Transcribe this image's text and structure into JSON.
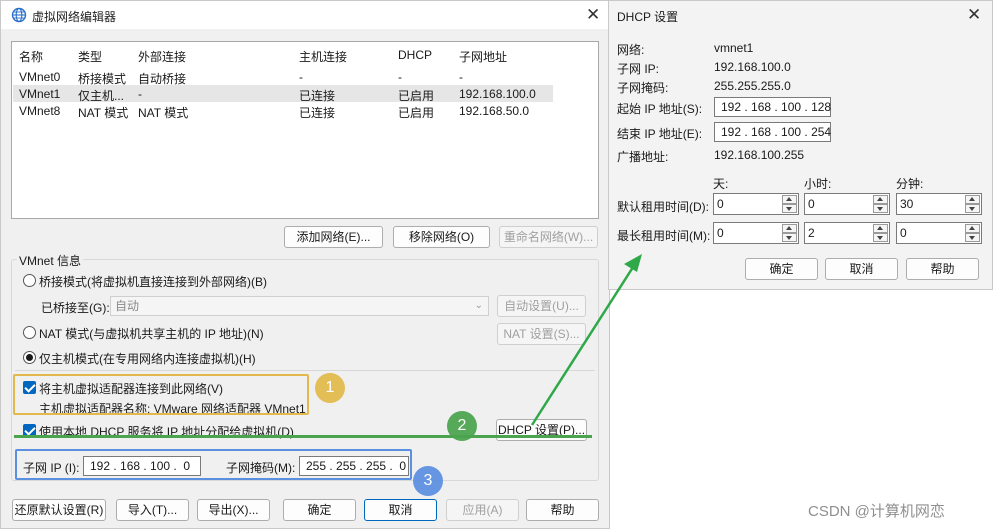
{
  "editor": {
    "title": "虚拟网络编辑器",
    "columns": [
      "名称",
      "类型",
      "外部连接",
      "主机连接",
      "DHCP",
      "子网地址"
    ],
    "rows": [
      [
        "VMnet0",
        "桥接模式",
        "自动桥接",
        "-",
        "-",
        "-"
      ],
      [
        "VMnet1",
        "仅主机...",
        "-",
        "已连接",
        "已启用",
        "192.168.100.0"
      ],
      [
        "VMnet8",
        "NAT 模式",
        "NAT 模式",
        "已连接",
        "已启用",
        "192.168.50.0"
      ]
    ],
    "buttons": {
      "add_network": "添加网络(E)...",
      "remove_network": "移除网络(O)",
      "rename_network": "重命名网络(W)..."
    },
    "vmnet_info": {
      "legend": "VMnet 信息",
      "bridged_mode": "桥接模式(将虚拟机直接连接到外部网络)(B)",
      "bridged_to_label": "已桥接至(G):",
      "bridged_to_value": "自动",
      "auto_settings": "自动设置(U)...",
      "nat_mode": "NAT 模式(与虚拟机共享主机的 IP 地址)(N)",
      "nat_settings": "NAT 设置(S)...",
      "host_only_mode": "仅主机模式(在专用网络内连接虚拟机)(H)",
      "connect_adapter": "将主机虚拟适配器连接到此网络(V)",
      "adapter_name": "主机虚拟适配器名称: VMware 网络适配器 VMnet1",
      "use_dhcp": "使用本地 DHCP 服务将 IP 地址分配给虚拟机(D)",
      "dhcp_settings": "DHCP 设置(P)...",
      "subnet_ip_label": "子网 IP (I):",
      "subnet_ip": "192 . 168 . 100 .  0",
      "subnet_mask_label": "子网掩码(M):",
      "subnet_mask": "255 . 255 . 255 .  0"
    },
    "footer": {
      "restore_defaults": "还原默认设置(R)",
      "import": "导入(T)...",
      "export": "导出(X)...",
      "ok": "确定",
      "cancel": "取消",
      "apply": "应用(A)",
      "help": "帮助"
    }
  },
  "dhcp": {
    "title": "DHCP 设置",
    "network_label": "网络:",
    "network_value": "vmnet1",
    "subnet_ip_label": "子网 IP:",
    "subnet_ip_value": "192.168.100.0",
    "subnet_mask_label": "子网掩码:",
    "subnet_mask_value": "255.255.255.0",
    "start_ip_label": "起始 IP 地址(S):",
    "start_ip_value": "192 . 168 . 100 . 128",
    "end_ip_label": "结束 IP 地址(E):",
    "end_ip_value": "192 . 168 . 100 . 254",
    "broadcast_label": "广播地址:",
    "broadcast_value": "192.168.100.255",
    "col_days": "天:",
    "col_hours": "小时:",
    "col_minutes": "分钟:",
    "default_lease_label": "默认租用时间(D):",
    "default_lease": {
      "days": "0",
      "hours": "0",
      "minutes": "30"
    },
    "max_lease_label": "最长租用时间(M):",
    "max_lease": {
      "days": "0",
      "hours": "2",
      "minutes": "0"
    },
    "ok": "确定",
    "cancel": "取消",
    "help": "帮助"
  },
  "annotations": {
    "one": "1",
    "two": "2",
    "three": "3",
    "colors": {
      "one": "#e2b94a",
      "two": "#4aa34d",
      "three": "#5b8fe0"
    }
  },
  "watermark": "CSDN @计算机网恋"
}
